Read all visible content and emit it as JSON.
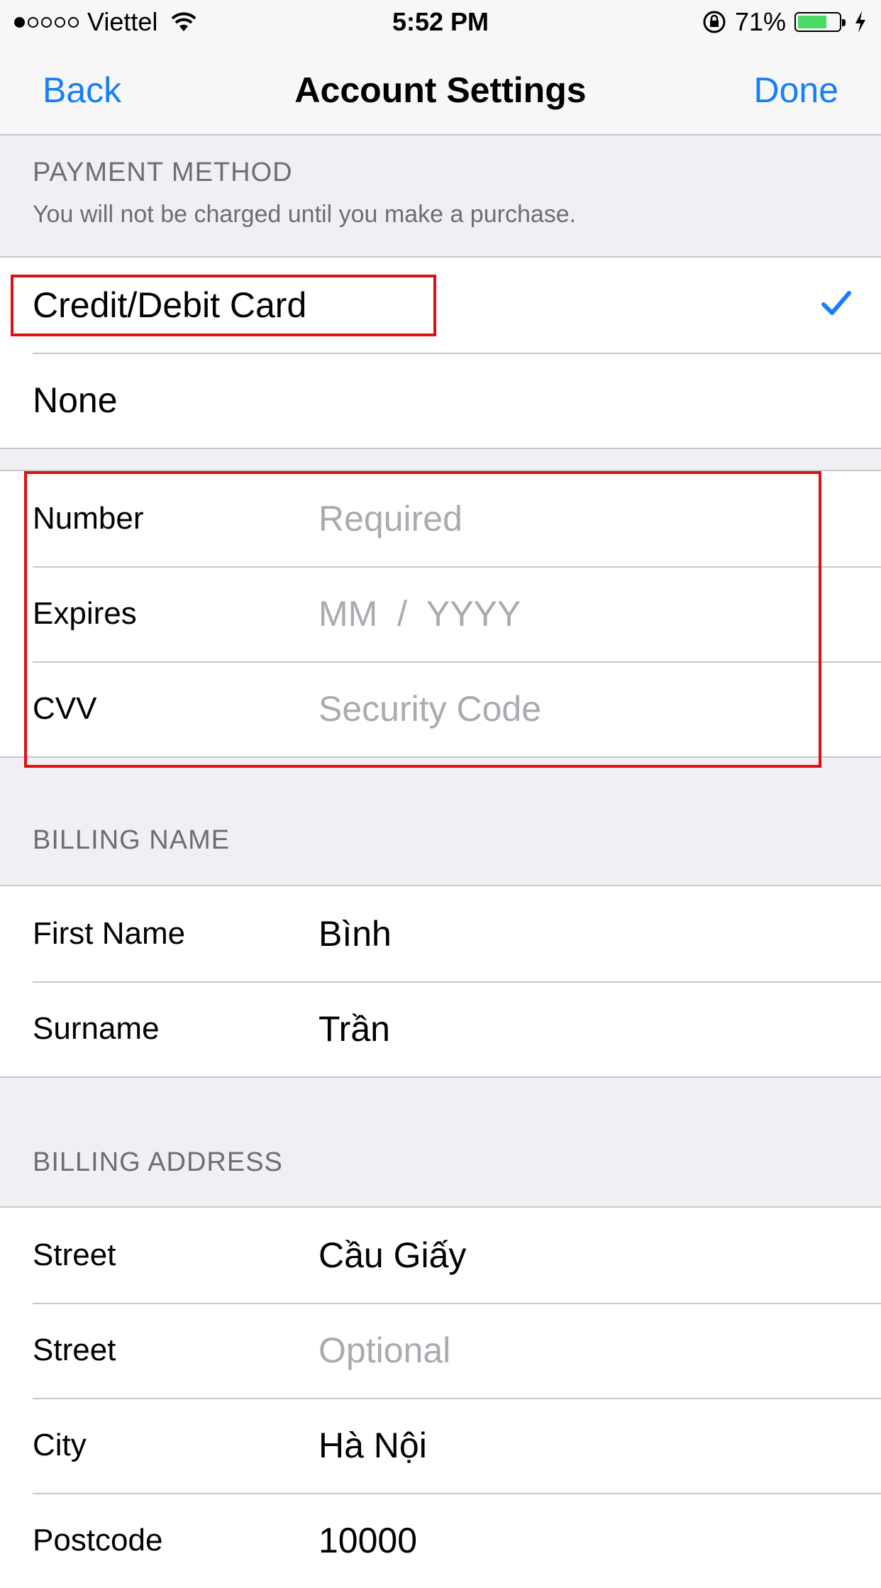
{
  "status_bar": {
    "carrier": "Viettel",
    "time": "5:52 PM",
    "battery_percent": "71%",
    "battery_level": 0.71,
    "icons": [
      "signal-dots",
      "wifi-icon",
      "rotation-lock-icon",
      "battery-icon",
      "charging-bolt-icon"
    ]
  },
  "nav": {
    "back_label": "Back",
    "title": "Account Settings",
    "done_label": "Done",
    "accent_color": "#157efb"
  },
  "payment": {
    "header": "PAYMENT METHOD",
    "subheader": "You will not be charged until you make a purchase.",
    "options": [
      {
        "label": "Credit/Debit Card",
        "selected": true
      },
      {
        "label": "None",
        "selected": false
      }
    ]
  },
  "card": {
    "fields": [
      {
        "label": "Number",
        "placeholder": "Required"
      },
      {
        "label": "Expires",
        "placeholder": "MM  /  YYYY"
      },
      {
        "label": "CVV",
        "placeholder": "Security Code"
      }
    ]
  },
  "billing_name": {
    "header": "BILLING NAME",
    "fields": [
      {
        "label": "First Name",
        "value": "Bình"
      },
      {
        "label": "Surname",
        "value": "Trần"
      }
    ]
  },
  "billing_address": {
    "header": "BILLING ADDRESS",
    "fields": [
      {
        "label": "Street",
        "value": "Cầu Giấy",
        "placeholder": ""
      },
      {
        "label": "Street",
        "value": "",
        "placeholder": "Optional"
      },
      {
        "label": "City",
        "value": "Hà Nội",
        "placeholder": ""
      },
      {
        "label": "Postcode",
        "value": "10000",
        "placeholder": ""
      }
    ]
  },
  "annotation_color": "#e01010"
}
